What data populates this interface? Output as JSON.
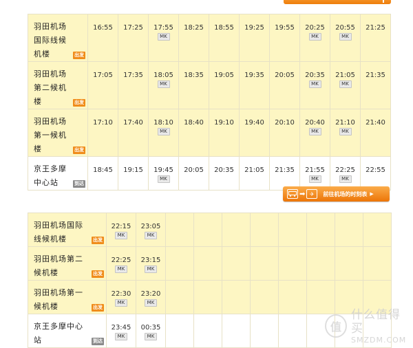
{
  "badges": {
    "departure": "出发",
    "arrival": "到达"
  },
  "mk_label": "MK",
  "table1": {
    "rows": [
      {
        "station": [
          "羽田机场",
          "国际线候",
          "机楼"
        ],
        "badge": "dep",
        "times": [
          {
            "t": "16:55"
          },
          {
            "t": "17:25"
          },
          {
            "t": "17:55",
            "mk": true
          },
          {
            "t": "18:25"
          },
          {
            "t": "18:55"
          },
          {
            "t": "19:25"
          },
          {
            "t": "19:55"
          },
          {
            "t": "20:25",
            "mk": true
          },
          {
            "t": "20:55",
            "mk": true
          },
          {
            "t": "21:25"
          }
        ]
      },
      {
        "station": [
          "羽田机场",
          "第二候机",
          "楼"
        ],
        "badge": "dep",
        "times": [
          {
            "t": "17:05"
          },
          {
            "t": "17:35"
          },
          {
            "t": "18:05",
            "mk": true
          },
          {
            "t": "18:35"
          },
          {
            "t": "19:05"
          },
          {
            "t": "19:35"
          },
          {
            "t": "20:05"
          },
          {
            "t": "20:35",
            "mk": true
          },
          {
            "t": "21:05",
            "mk": true
          },
          {
            "t": "21:35"
          }
        ]
      },
      {
        "station": [
          "羽田机场",
          "第一候机",
          "楼"
        ],
        "badge": "dep",
        "times": [
          {
            "t": "17:10"
          },
          {
            "t": "17:40"
          },
          {
            "t": "18:10",
            "mk": true
          },
          {
            "t": "18:40"
          },
          {
            "t": "19:10"
          },
          {
            "t": "19:40"
          },
          {
            "t": "20:10"
          },
          {
            "t": "20:40",
            "mk": true
          },
          {
            "t": "21:10",
            "mk": true
          },
          {
            "t": "21:40"
          }
        ]
      },
      {
        "station": [
          "京王多摩",
          "中心站"
        ],
        "badge": "arr",
        "times": [
          {
            "t": "18:45"
          },
          {
            "t": "19:15"
          },
          {
            "t": "19:45",
            "mk": true
          },
          {
            "t": "20:05"
          },
          {
            "t": "20:35"
          },
          {
            "t": "21:05"
          },
          {
            "t": "21:35"
          },
          {
            "t": "21:55",
            "mk": true
          },
          {
            "t": "22:25",
            "mk": true
          },
          {
            "t": "22:55"
          }
        ]
      }
    ]
  },
  "to_airport_button": {
    "label": "前往机场的时刻表",
    "bus_icon": "bus-icon",
    "arrow_icon": "arrow-right-icon",
    "plane_icon": "airplane-icon"
  },
  "table2": {
    "rows": [
      {
        "station": [
          "羽田机场国际",
          "线候机楼"
        ],
        "badge": "dep",
        "times": [
          {
            "t": "22:15",
            "mk": true
          },
          {
            "t": "23:05",
            "mk": true
          }
        ]
      },
      {
        "station": [
          "羽田机场第二",
          "候机楼"
        ],
        "badge": "dep",
        "times": [
          {
            "t": "22:25",
            "mk": true
          },
          {
            "t": "23:15",
            "mk": true
          }
        ]
      },
      {
        "station": [
          "羽田机场第一",
          "候机楼"
        ],
        "badge": "dep",
        "times": [
          {
            "t": "22:30",
            "mk": true
          },
          {
            "t": "23:20",
            "mk": true
          }
        ]
      },
      {
        "station": [
          "京王多摩中心",
          "站"
        ],
        "badge": "arr",
        "times": [
          {
            "t": "23:45",
            "mk": true
          },
          {
            "t": "00:35",
            "mk": true
          }
        ]
      }
    ],
    "empty_columns": 8
  },
  "watermark": {
    "cn": "什么值得买",
    "en": "SMZDM.COM",
    "glyph": "值"
  }
}
